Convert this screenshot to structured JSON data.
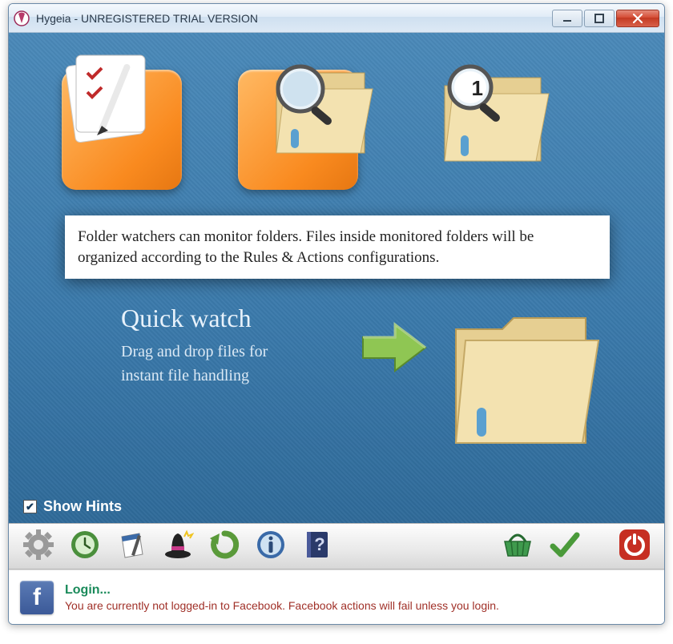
{
  "titlebar": {
    "title": "Hygeia - UNREGISTERED TRIAL VERSION"
  },
  "tooltip": {
    "text": "Folder watchers can monitor folders. Files inside monitored folders will be organized according to the Rules & Actions configurations."
  },
  "badge": {
    "count": "1"
  },
  "quickwatch": {
    "title": "Quick watch",
    "sub1": "Drag and drop files for",
    "sub2": "instant file handling"
  },
  "show_hints": {
    "label": "Show Hints",
    "checked": true
  },
  "status": {
    "login_label": "Login...",
    "warning": "You are currently not logged-in to Facebook. Facebook actions will fail unless you login."
  }
}
